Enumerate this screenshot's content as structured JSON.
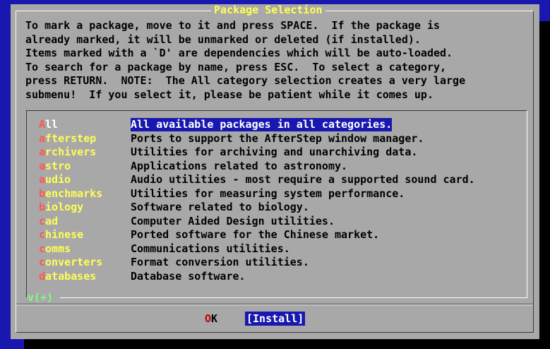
{
  "dialog": {
    "title": "Package Selection",
    "instructions": [
      "To mark a package, move to it and press SPACE.  If the package is",
      "already marked, it will be unmarked or deleted (if installed).",
      "Items marked with a `D' are dependencies which will be auto-loaded.",
      "To search for a package by name, press ESC.  To select a category,",
      "press RETURN.  NOTE:  The All category selection creates a very large",
      "submenu!  If you select it, please be patient while it comes up."
    ]
  },
  "categories": [
    {
      "hotkey": "A",
      "rest": "ll",
      "description": "All available packages in all categories.",
      "selected": true
    },
    {
      "hotkey": "a",
      "rest": "fterstep",
      "description": "Ports to support the AfterStep window manager.",
      "selected": false
    },
    {
      "hotkey": "a",
      "rest": "rchivers",
      "description": "Utilities for archiving and unarchiving data.",
      "selected": false
    },
    {
      "hotkey": "a",
      "rest": "stro",
      "description": "Applications related to astronomy.",
      "selected": false
    },
    {
      "hotkey": "a",
      "rest": "udio",
      "description": "Audio utilities - most require a supported sound card.",
      "selected": false
    },
    {
      "hotkey": "b",
      "rest": "enchmarks",
      "description": "Utilities for measuring system performance.",
      "selected": false
    },
    {
      "hotkey": "b",
      "rest": "iology",
      "description": "Software related to biology.",
      "selected": false
    },
    {
      "hotkey": "c",
      "rest": "ad",
      "description": "Computer Aided Design utilities.",
      "selected": false
    },
    {
      "hotkey": "c",
      "rest": "hinese",
      "description": "Ported software for the Chinese market.",
      "selected": false
    },
    {
      "hotkey": "c",
      "rest": "omms",
      "description": "Communications utilities.",
      "selected": false
    },
    {
      "hotkey": "c",
      "rest": "onverters",
      "description": "Format conversion utilities.",
      "selected": false
    },
    {
      "hotkey": "d",
      "rest": "atabases",
      "description": "Database software.",
      "selected": false
    }
  ],
  "scroll_indicator": "v(+)",
  "buttons": {
    "ok_hotkey": "O",
    "ok_rest": "K",
    "install_label": "[Install]"
  },
  "colors": {
    "screen_bg": "#1818b0",
    "dialog_bg": "#a8a8a8",
    "title": "#ffff55",
    "hotkey": "#ff5555",
    "category_name": "#ffff55",
    "selection_bg": "#1818b0"
  }
}
